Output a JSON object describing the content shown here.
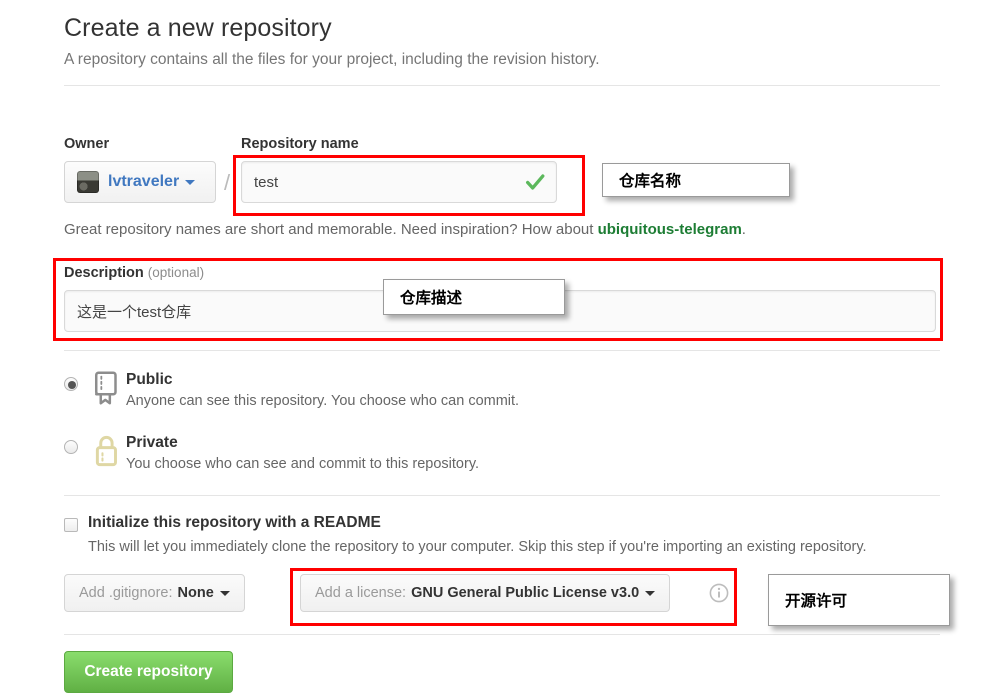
{
  "header": {
    "title": "Create a new repository",
    "subtitle": "A repository contains all the files for your project, including the revision history."
  },
  "owner": {
    "label": "Owner",
    "name": "lvtraveler",
    "avatar_icon": "user-avatar-image",
    "caret_icon": "chevron-down-icon",
    "separator": "/"
  },
  "repository_name": {
    "label": "Repository name",
    "value": "test",
    "placeholder": "",
    "valid_icon": "green-check-icon"
  },
  "hint": {
    "prefix": "Great repository names are short and memorable. Need inspiration? How about ",
    "suggestion": "ubiquitous-telegram",
    "suffix": ".",
    "suggestion_color": "#1d7d34"
  },
  "description": {
    "label": "Description",
    "optional": "(optional)",
    "value": "这是一个test仓库",
    "placeholder": ""
  },
  "visibility": {
    "options": [
      {
        "id": "public",
        "title": "Public",
        "description": "Anyone can see this repository. You choose who can commit.",
        "icon": "repo-book-icon",
        "selected": true
      },
      {
        "id": "private",
        "title": "Private",
        "description": "You choose who can see and commit to this repository.",
        "icon": "lock-icon",
        "selected": false
      }
    ]
  },
  "readme": {
    "title": "Initialize this repository with a README",
    "description": "This will let you immediately clone the repository to your computer. Skip this step if you're importing an existing repository.",
    "checked": false
  },
  "gitignore": {
    "prefix": "Add .gitignore:",
    "value": "None",
    "caret_icon": "chevron-down-icon"
  },
  "license": {
    "prefix": "Add a license:",
    "value": "GNU General Public License v3.0",
    "caret_icon": "chevron-down-icon",
    "info_icon": "info-circle-icon"
  },
  "submit": {
    "label": "Create repository",
    "color": "#60b044"
  },
  "annotations": {
    "highlight_color": "#ff0000",
    "callouts": [
      {
        "text": "仓库名称"
      },
      {
        "text": "仓库描述"
      },
      {
        "text": "开源许可"
      }
    ]
  }
}
